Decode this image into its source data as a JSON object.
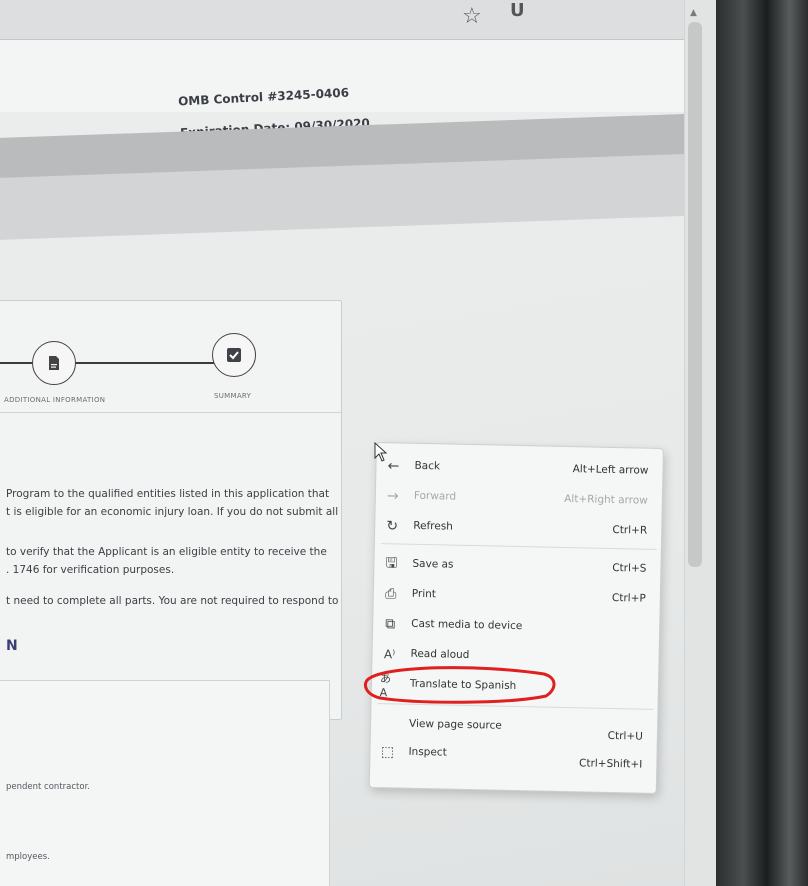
{
  "header": {
    "omb_control": "OMB Control #3245-0406",
    "expiration": "Expiration Date: 09/30/2020"
  },
  "progress": {
    "steps": [
      {
        "label": "ADDITIONAL INFORMATION",
        "icon": "document-icon"
      },
      {
        "label": "SUMMARY",
        "icon": "checkbox-icon"
      }
    ]
  },
  "body": {
    "lines": [
      "Program to the qualified entities listed in this application that",
      "t is eligible for an economic injury loan. If you do not submit all",
      "to verify that the Applicant is an eligible entity to receive the",
      ". 1746 for verification purposes.",
      "t need to complete all parts. You are not required to respond to"
    ],
    "heading": "N",
    "small_lines": [
      "pendent contractor.",
      "mployees."
    ]
  },
  "context_menu": {
    "items": [
      {
        "label": "Back",
        "shortcut": "Alt+Left arrow",
        "icon": "back-arrow-icon",
        "enabled": true
      },
      {
        "label": "Forward",
        "shortcut": "Alt+Right arrow",
        "icon": "forward-arrow-icon",
        "enabled": false
      },
      {
        "label": "Refresh",
        "shortcut": "Ctrl+R",
        "icon": "refresh-icon",
        "enabled": true
      },
      {
        "label": "Save as",
        "shortcut": "Ctrl+S",
        "icon": "save-icon",
        "enabled": true
      },
      {
        "label": "Print",
        "shortcut": "Ctrl+P",
        "icon": "print-icon",
        "enabled": true
      },
      {
        "label": "Cast media to device",
        "shortcut": "",
        "icon": "cast-icon",
        "enabled": true
      },
      {
        "label": "Read aloud",
        "shortcut": "",
        "icon": "read-aloud-icon",
        "enabled": true
      },
      {
        "label": "Translate to Spanish",
        "shortcut": "",
        "icon": "translate-icon",
        "enabled": true
      },
      {
        "label": "View page source",
        "shortcut": "Ctrl+U",
        "icon": "",
        "enabled": true
      },
      {
        "label": "Inspect",
        "shortcut": "Ctrl+Shift+I",
        "icon": "inspect-icon",
        "enabled": true
      }
    ]
  },
  "colors": {
    "annotation": "#e0201e",
    "heading": "#3c3f74"
  }
}
